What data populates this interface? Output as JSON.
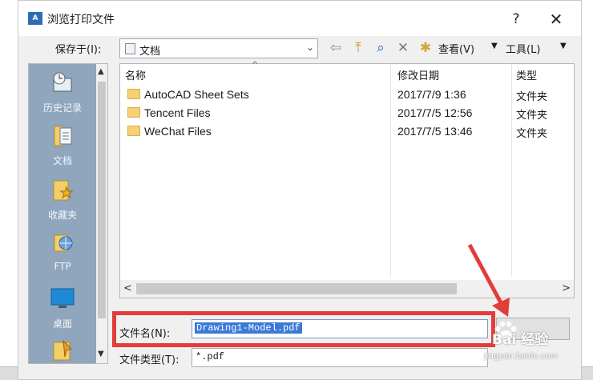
{
  "window": {
    "title": "浏览打印文件",
    "icon_text": "A",
    "help_label": "?",
    "close_label": "✕"
  },
  "toolbar": {
    "save_in_label": "保存于(I):",
    "save_in_value": "文档",
    "dropdown_arrow": "⌄",
    "views_label": "查看(V)",
    "views_arrow": "▼",
    "tools_label": "工具(L)",
    "tools_arrow": "▼",
    "icons": [
      "back-icon",
      "up-folder-icon",
      "search-icon",
      "delete-icon",
      "new-folder-icon"
    ]
  },
  "places": {
    "items": [
      {
        "label": "历史记录",
        "icon": "history-icon"
      },
      {
        "label": "文档",
        "icon": "documents-icon"
      },
      {
        "label": "收藏夹",
        "icon": "favorites-icon"
      },
      {
        "label": "FTP",
        "icon": "ftp-icon"
      },
      {
        "label": "桌面",
        "icon": "desktop-icon"
      },
      {
        "label": "",
        "icon": "buzzsaw-icon"
      }
    ],
    "scroll_up": "▲",
    "scroll_down": "▼"
  },
  "file_list": {
    "sort_indicator": "^",
    "columns": {
      "name": "名称",
      "date": "修改日期",
      "type": "类型"
    },
    "rows": [
      {
        "name": "AutoCAD Sheet Sets",
        "date": "2017/7/9 1:36",
        "type": "文件夹"
      },
      {
        "name": "Tencent Files",
        "date": "2017/7/5 12:56",
        "type": "文件夹"
      },
      {
        "name": "WeChat Files",
        "date": "2017/7/5 13:46",
        "type": "文件夹"
      }
    ],
    "scroll_left": "<",
    "scroll_right": ">"
  },
  "filename": {
    "label": "文件名(N):",
    "value": "Drawing1-Model.pdf"
  },
  "filetype": {
    "label": "文件类型(T):",
    "value": "*.pdf"
  },
  "watermark": {
    "brand": "Bai 经验",
    "url": "jingyan.baidu.com"
  },
  "colors": {
    "highlight": "#e23d3a",
    "selection": "#3b79d8",
    "places_bg": "#8fa6bd",
    "folder": "#f5d174"
  }
}
